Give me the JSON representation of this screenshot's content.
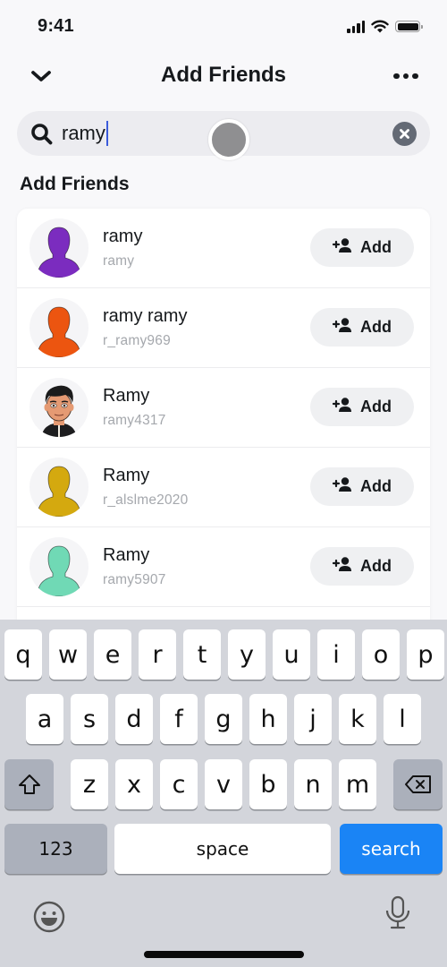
{
  "status_bar": {
    "time": "9:41",
    "icons": [
      "cellular-signal-icon",
      "wifi-icon",
      "battery-icon"
    ]
  },
  "header": {
    "back_icon": "chevron-down-icon",
    "title": "Add Friends",
    "more_icon": "more-horizontal-icon"
  },
  "search": {
    "icon": "search-icon",
    "value": "ramy",
    "clear_icon": "clear-icon"
  },
  "section": {
    "heading": "Add Friends"
  },
  "results": [
    {
      "name": "ramy",
      "username": "ramy",
      "avatar": "silhouette",
      "avatar_color": "#7b2cbf",
      "add_label": "Add"
    },
    {
      "name": "ramy ramy",
      "username": "r_ramy969",
      "avatar": "silhouette",
      "avatar_color": "#ec5510",
      "add_label": "Add"
    },
    {
      "name": "Ramy",
      "username": "ramy4317",
      "avatar": "bitmoji",
      "avatar_color": "#e59a73",
      "add_label": "Add"
    },
    {
      "name": "Ramy",
      "username": "r_alslme2020",
      "avatar": "silhouette",
      "avatar_color": "#d4a90f",
      "add_label": "Add"
    },
    {
      "name": "Ramy",
      "username": "ramy5907",
      "avatar": "silhouette",
      "avatar_color": "#70d9b5",
      "add_label": "Add"
    }
  ],
  "keyboard": {
    "row1": [
      "q",
      "w",
      "e",
      "r",
      "t",
      "y",
      "u",
      "i",
      "o",
      "p"
    ],
    "row2": [
      "a",
      "s",
      "d",
      "f",
      "g",
      "h",
      "j",
      "k",
      "l"
    ],
    "row3": [
      "z",
      "x",
      "c",
      "v",
      "b",
      "n",
      "m"
    ],
    "shift_icon": "shift-icon",
    "delete_icon": "backspace-icon",
    "numbers_label": "123",
    "space_label": "space",
    "action_label": "search",
    "emoji_icon": "emoji-icon",
    "mic_icon": "microphone-icon"
  },
  "colors": {
    "accent_blue": "#1a84f5",
    "caret": "#3b5bdb",
    "keyboard_bg": "#d3d5db"
  }
}
